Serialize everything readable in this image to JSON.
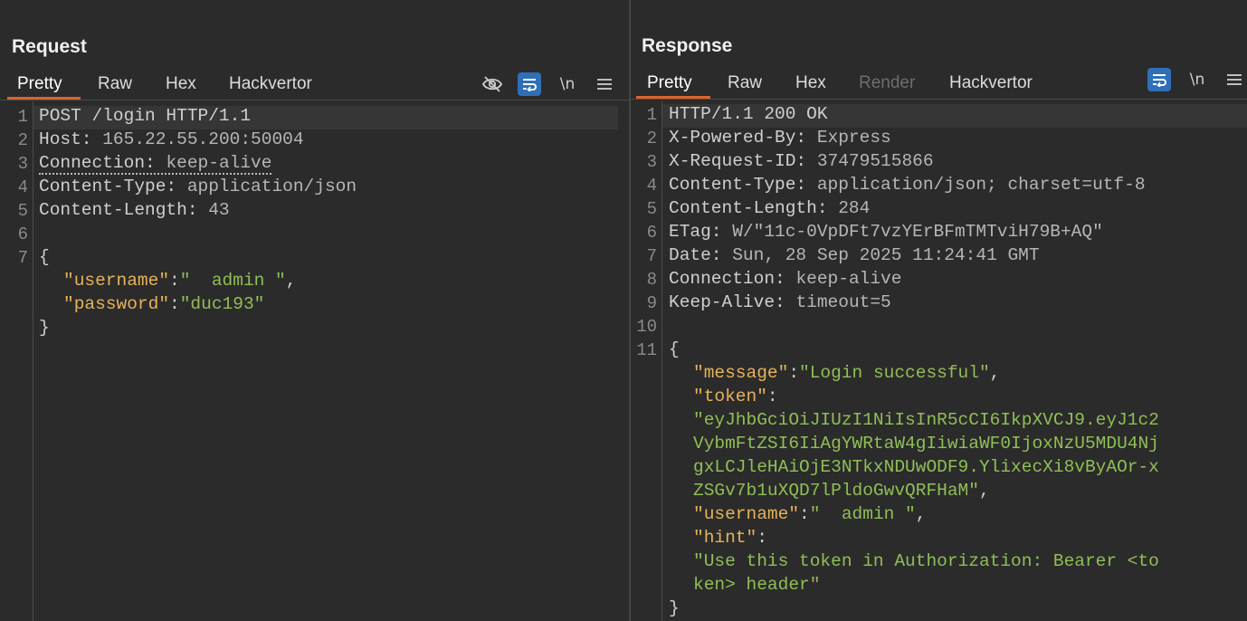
{
  "layout_toggle": {
    "icons": [
      "split-vertical-icon",
      "split-horizontal-icon",
      "single-pane-icon"
    ],
    "active": "split-vertical-icon"
  },
  "request": {
    "title": "Request",
    "tabs": [
      {
        "label": "Pretty",
        "active": true
      },
      {
        "label": "Raw"
      },
      {
        "label": "Hex"
      },
      {
        "label": "Hackvertor"
      }
    ],
    "toolbar": {
      "hide_icon": "eye-off-icon",
      "wrap_icon": "word-wrap-icon",
      "newline_label": "\\n",
      "menu_icon": "hamburger-menu-icon"
    },
    "lines": {
      "l1": "POST /login HTTP/1.1",
      "l2_name": "Host: ",
      "l2_val": "165.22.55.200:50004",
      "l3_name": "Connection: ",
      "l3_val": "keep-alive",
      "l4_name": "Content-Type: ",
      "l4_val": "application/json",
      "l5_name": "Content-Length: ",
      "l5_val": "43",
      "l7": "{",
      "body_k1": "\"username\"",
      "body_v1": "\"  admin \"",
      "body_k2": "\"password\"",
      "body_v2": "\"duc193\"",
      "close": "}"
    },
    "line_numbers": [
      "1",
      "2",
      "3",
      "4",
      "5",
      "6",
      "7"
    ]
  },
  "response": {
    "title": "Response",
    "tabs": [
      {
        "label": "Pretty",
        "active": true
      },
      {
        "label": "Raw"
      },
      {
        "label": "Hex"
      },
      {
        "label": "Render",
        "disabled": true
      },
      {
        "label": "Hackvertor"
      }
    ],
    "toolbar": {
      "wrap_icon": "word-wrap-icon",
      "newline_label": "\\n",
      "menu_icon": "hamburger-menu-icon"
    },
    "lines": {
      "l1": "HTTP/1.1 200 OK",
      "l2_name": "X-Powered-By: ",
      "l2_val": "Express",
      "l3_name": "X-Request-ID: ",
      "l3_val": "37479515866",
      "l4_name": "Content-Type: ",
      "l4_val": "application/json; charset=utf-8",
      "l5_name": "Content-Length: ",
      "l5_val": "284",
      "l6_name": "ETag: ",
      "l6_val": "W/\"11c-0VpDFt7vzYErBFmTMTviH79B+AQ\"",
      "l7_name": "Date: ",
      "l7_val": "Sun, 28 Sep 2025 11:24:41 GMT",
      "l8_name": "Connection: ",
      "l8_val": "keep-alive",
      "l9_name": "Keep-Alive: ",
      "l9_val": "timeout=5",
      "l11": "{",
      "k_message": "\"message\"",
      "v_message": "\"Login successful\"",
      "k_token": "\"token\"",
      "v_token_1": "\"eyJhbGciOiJIUzI1NiIsInR5cCI6IkpXVCJ9.eyJ1c2",
      "v_token_2": "VybmFtZSI6IiAgYWRtaW4gIiwiaWF0IjoxNzU5MDU4Nj",
      "v_token_3": "gxLCJleHAiOjE3NTkxNDUwODF9.YlixecXi8vByAOr-x",
      "v_token_4": "ZSGv7b1uXQD7lPldoGwvQRFHaM\"",
      "k_username": "\"username\"",
      "v_username": "\"  admin \"",
      "k_hint": "\"hint\"",
      "v_hint_1": "\"Use this token in Authorization: Bearer <to",
      "v_hint_2": "ken> header\"",
      "close": "}"
    },
    "line_numbers": [
      "1",
      "2",
      "3",
      "4",
      "5",
      "6",
      "7",
      "8",
      "9",
      "10",
      "11"
    ]
  }
}
